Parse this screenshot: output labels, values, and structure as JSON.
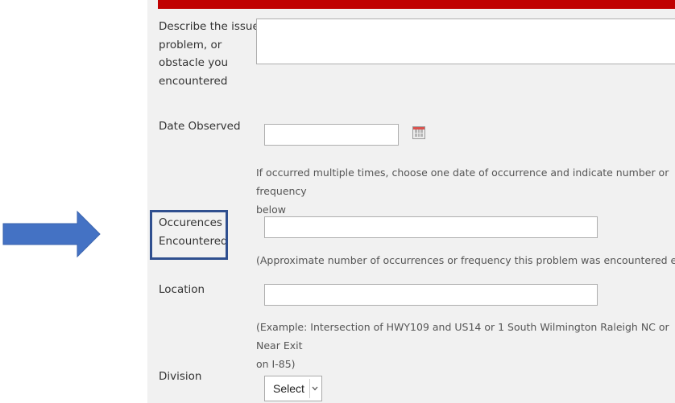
{
  "form": {
    "issue": {
      "label": "Describe the issue,\nproblem, or\nobstacle you\nencountered",
      "value": ""
    },
    "date_observed": {
      "label": "Date Observed",
      "value": "",
      "calendar_icon": "calendar-icon",
      "help": "If occurred multiple times, choose one date of occurrence and indicate number or frequency\nbelow"
    },
    "occurrences": {
      "label": "Occurences\nEncountered",
      "value": "",
      "help": "(Approximate number of occurrences or frequency this problem was encountered earlier)"
    },
    "location": {
      "label": "Location",
      "value": "",
      "help": "(Example: Intersection of HWY109 and US14 or 1 South Wilmington Raleigh NC or Near Exit\non I-85)"
    },
    "division": {
      "label": "Division",
      "selected": "Select",
      "chevron_icon": "chevron-down-icon"
    }
  },
  "annotation": {
    "arrow_color": "#4472c4",
    "box_color": "#2f4f8f"
  },
  "colors": {
    "header_bar": "#c00000",
    "panel_bg": "#f1f1f1"
  }
}
